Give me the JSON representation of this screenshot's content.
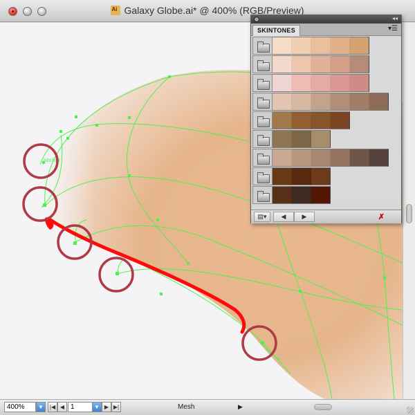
{
  "window": {
    "title": "Galaxy Globe.ai* @ 400% (RGB/Preview)",
    "doc_icon": "illustrator-doc-icon"
  },
  "status": {
    "zoom": "400%",
    "page": "1",
    "tool_readout": "Mesh"
  },
  "canvas": {
    "anchor_label": "anchor"
  },
  "panel": {
    "tab_label": "SKINTONES",
    "rows": [
      [
        "#f4dcc7",
        "#f0cfb3",
        "#e9c09b",
        "#e1b089",
        "#d4a173"
      ],
      [
        "#f2d9ca",
        "#ecc6ad",
        "#e1b198",
        "#d59e88",
        "#b58b79"
      ],
      [
        "#f0d6d3",
        "#ecbcb5",
        "#e4aaa5",
        "#d99894",
        "#cf8b85"
      ],
      [
        "#e3c5b1",
        "#d7b8a1",
        "#c3a38a",
        "#b08f76",
        "#a07e67",
        "#8d6c58"
      ],
      [
        "#a07a4c",
        "#925f32",
        "#86552c",
        "#7b4523"
      ],
      [
        "#8e7452",
        "#7d6547",
        "#a68e6d"
      ],
      [
        "#c9a893",
        "#b99880",
        "#a88670",
        "#957360",
        "#6f5448",
        "#55423c"
      ],
      [
        "#6a3a16",
        "#5a2a10",
        "#6e3a1a"
      ],
      [
        "#583019",
        "#3e2a20",
        "#541505"
      ]
    ]
  },
  "colors": {
    "mesh_green": "#4ef04e",
    "highlight_red": "#ff0a0a",
    "circle_red": "#b03a45",
    "skin": "#e8b991"
  }
}
